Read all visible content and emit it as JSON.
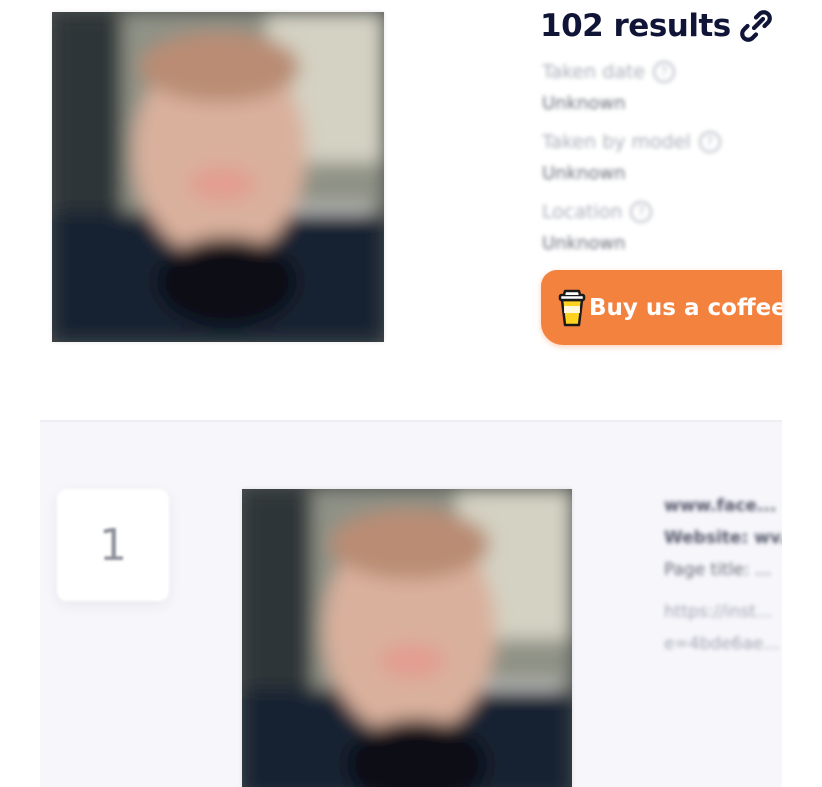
{
  "summary": {
    "results_count": "102 results",
    "share_icon": "link-icon",
    "meta": [
      {
        "label": "Taken date",
        "value": "Unknown"
      },
      {
        "label": "Taken by model",
        "value": "Unknown"
      },
      {
        "label": "Location",
        "value": "Unknown"
      }
    ],
    "donate_button": {
      "label": "Buy us a coffee",
      "icon": "coffee-cup-icon",
      "color": "#f4823f"
    }
  },
  "results": [
    {
      "rank": "1",
      "details": {
        "line1": "www.face...",
        "line2": "Website: wv...",
        "line3": "Page title: ...",
        "line4": "https://inst...",
        "line5": "e=4bde6ae..."
      }
    }
  ],
  "colors": {
    "title": "#101436",
    "accent_orange": "#f4823f",
    "list_background": "#f6f6fb"
  }
}
